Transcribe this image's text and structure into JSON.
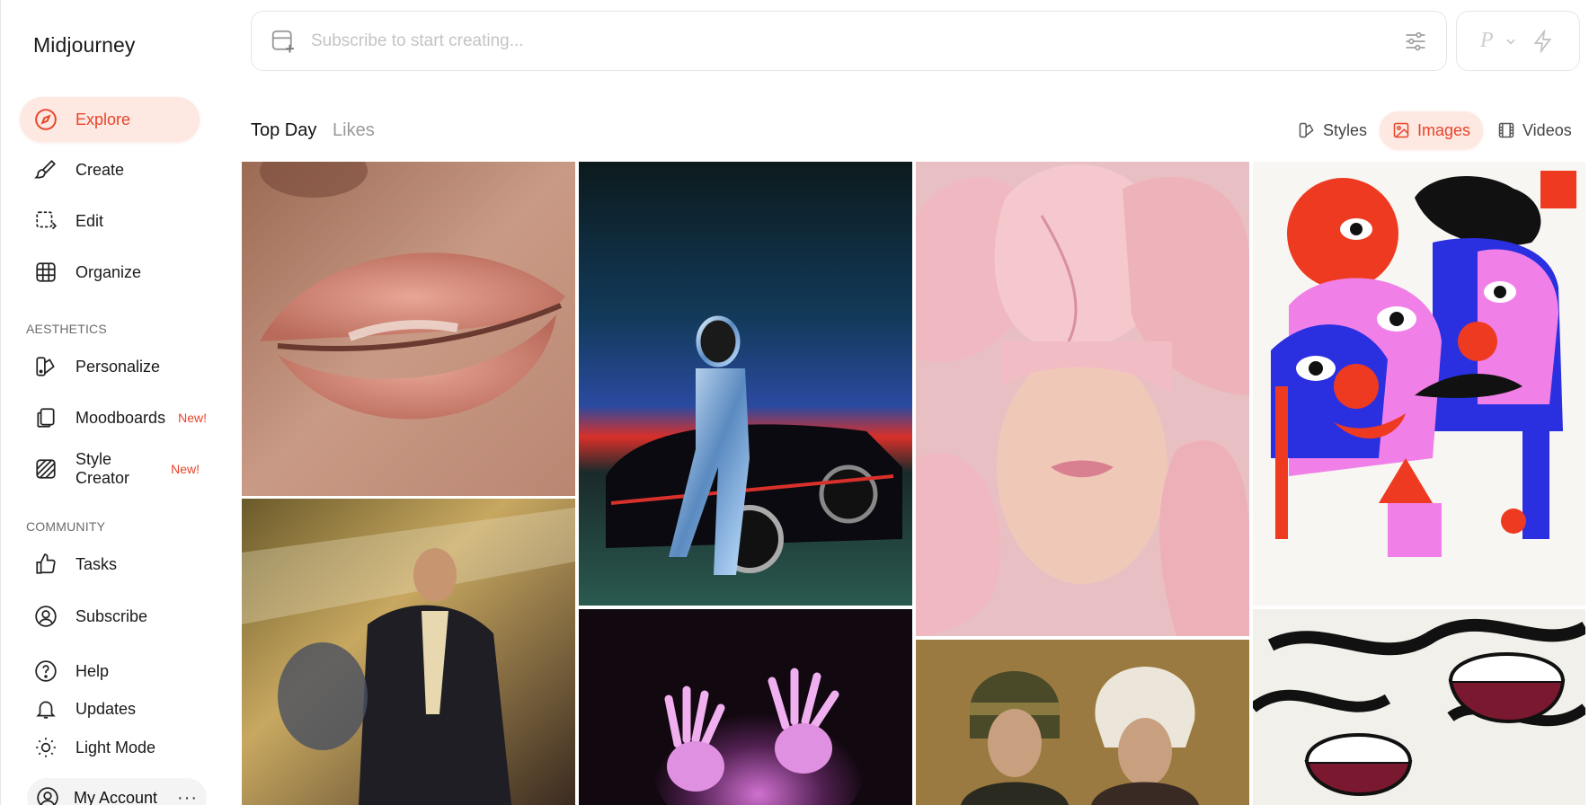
{
  "app": {
    "title": "Midjourney"
  },
  "nav": {
    "explore": "Explore",
    "create": "Create",
    "edit": "Edit",
    "organize": "Organize",
    "aesthetics_label": "AESTHETICS",
    "personalize": "Personalize",
    "moodboards": "Moodboards",
    "moodboards_badge": "New!",
    "style_creator": "Style Creator",
    "style_creator_badge": "New!",
    "community_label": "COMMUNITY",
    "tasks": "Tasks",
    "subscribe": "Subscribe",
    "help": "Help",
    "updates": "Updates",
    "light_mode": "Light Mode",
    "my_account": "My Account",
    "more": "···"
  },
  "prompt": {
    "placeholder": "Subscribe to start creating..."
  },
  "mode": {
    "letter": "P"
  },
  "feed": {
    "tab_top_day": "Top Day",
    "tab_likes": "Likes"
  },
  "filters": {
    "styles": "Styles",
    "images": "Images",
    "videos": "Videos",
    "active": "images"
  },
  "colors": {
    "accent": "#e8442a",
    "accent_bg": "#fde8e2"
  },
  "gallery": [
    {
      "name": "lips-closeup"
    },
    {
      "name": "chrome-astronaut-car"
    },
    {
      "name": "pink-tulip-face"
    },
    {
      "name": "illustrated-poster"
    },
    {
      "name": "blurred-man-running"
    },
    {
      "name": "glowing-hands"
    },
    {
      "name": "two-women-hats"
    },
    {
      "name": "wine-glasses-illustration"
    }
  ]
}
